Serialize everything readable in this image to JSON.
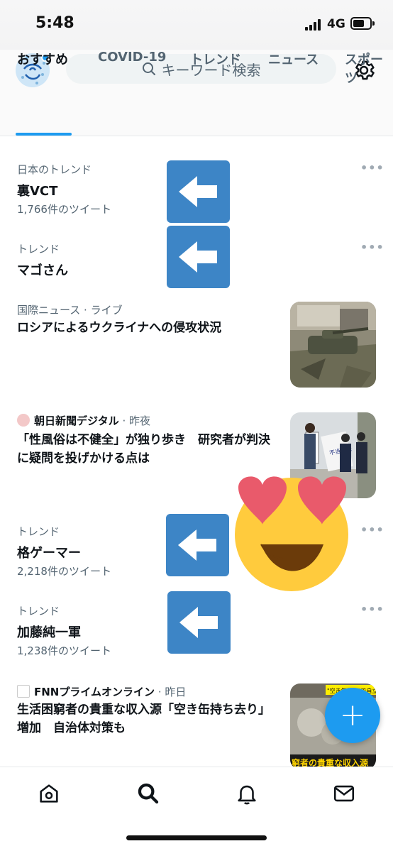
{
  "status_bar": {
    "time": "5:48",
    "network": "4G"
  },
  "header": {
    "search_placeholder": "キーワード検索",
    "tabs": [
      "おすすめ",
      "COVID-19",
      "トレンド",
      "ニュース",
      "スポーツ"
    ],
    "active_tab": "おすすめ"
  },
  "feed": {
    "items": [
      {
        "meta": "日本のトレンド",
        "title": "裏VCT",
        "count": "1,766件のツイート"
      },
      {
        "meta": "トレンド",
        "title": "マゴさん"
      },
      {
        "meta": "国際ニュース",
        "meta_suffix": " · ライブ",
        "title": "ロシアによるウクライナへの侵攻状況"
      },
      {
        "source": "朝日新聞デジタル",
        "time": " · 昨夜",
        "title": "「性風俗は不健全」が独り歩き　研究者が判決に疑問を投げかける点は"
      },
      {
        "meta": "トレンド",
        "title": "格ゲーマー",
        "count": "2,218件のツイート"
      },
      {
        "meta": "トレンド",
        "title": "加藤純一軍",
        "count": "1,238件のツイート"
      },
      {
        "source": "FNNプライムオンライン",
        "time": " · 昨日",
        "title": "生活困窮者の貴重な収入源「空き缶持ち去り」増加　自治体対策も"
      }
    ],
    "more_label": "•••"
  },
  "thumbnails": {
    "news_sign": "不当判決",
    "fnn_caption": "\"空き缶収集\"で自立",
    "fnn_subtitle": "窮者の貴重な収入源"
  },
  "fab_label": "+",
  "colors": {
    "accent": "#1d9bf0",
    "arrow_box": "#3d85c6",
    "muted": "#536471"
  },
  "icons": [
    "search-icon",
    "gear-icon",
    "home-icon",
    "bell-icon",
    "mail-icon",
    "left-arrow-icon",
    "heart-eyes-emoji"
  ]
}
